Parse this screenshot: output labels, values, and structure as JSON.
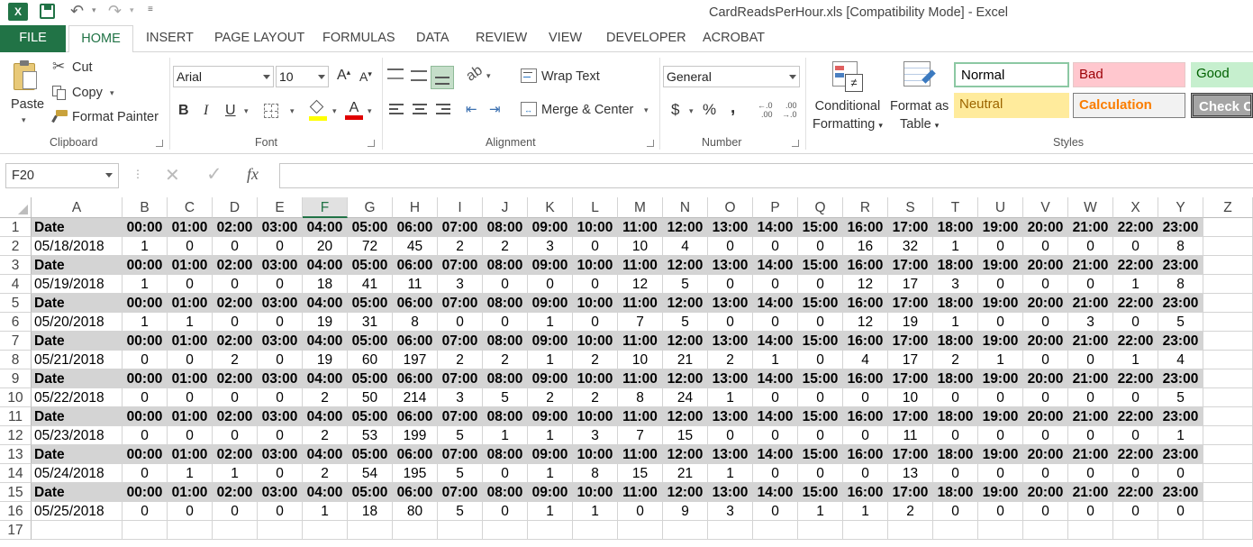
{
  "window": {
    "title": "CardReadsPerHour.xls  [Compatibility Mode] - Excel"
  },
  "tabs": [
    "FILE",
    "HOME",
    "INSERT",
    "PAGE LAYOUT",
    "FORMULAS",
    "DATA",
    "REVIEW",
    "VIEW",
    "DEVELOPER",
    "ACROBAT"
  ],
  "clipboard": {
    "paste": "Paste",
    "cut": "Cut",
    "copy": "Copy",
    "format_painter": "Format Painter",
    "label": "Clipboard"
  },
  "font": {
    "name": "Arial",
    "size": "10",
    "label": "Font",
    "bold": "B",
    "italic": "I",
    "underline": "U",
    "grow": "A",
    "shrink": "A",
    "font_color_letter": "A"
  },
  "alignment": {
    "wrap_text": "Wrap Text",
    "merge_center": "Merge & Center",
    "label": "Alignment"
  },
  "number": {
    "format": "General",
    "currency": "$",
    "percent": "%",
    "comma": ",",
    "inc_decimal": "←.0\n.00",
    "label": "Number"
  },
  "conditional": {
    "line1": "Conditional",
    "line2": "Formatting"
  },
  "format_table": {
    "line1": "Format as",
    "line2": "Table"
  },
  "styles": {
    "label": "Styles",
    "normal": "Normal",
    "bad": "Bad",
    "good": "Good",
    "neutral": "Neutral",
    "calculation": "Calculation",
    "check_cell": "Check Cell"
  },
  "formula_bar": {
    "name_box": "F20",
    "fx": "fx",
    "value": ""
  },
  "colors": {
    "accent": "#217346",
    "header_fill": "#d4d4d4"
  },
  "sheet": {
    "columns": [
      "A",
      "B",
      "C",
      "D",
      "E",
      "F",
      "G",
      "H",
      "I",
      "J",
      "K",
      "L",
      "M",
      "N",
      "O",
      "P",
      "Q",
      "R",
      "S",
      "T",
      "U",
      "V",
      "W",
      "X",
      "Y",
      "Z"
    ],
    "selected_column": "F",
    "row_numbers": [
      "1",
      "2",
      "3",
      "4",
      "5",
      "6",
      "7",
      "8",
      "9",
      "10",
      "11",
      "12",
      "13",
      "14",
      "15",
      "16",
      "17"
    ],
    "header_row": [
      "Date",
      "00:00",
      "01:00",
      "02:00",
      "03:00",
      "04:00",
      "05:00",
      "06:00",
      "07:00",
      "08:00",
      "09:00",
      "10:00",
      "11:00",
      "12:00",
      "13:00",
      "14:00",
      "15:00",
      "16:00",
      "17:00",
      "18:00",
      "19:00",
      "20:00",
      "21:00",
      "22:00",
      "23:00"
    ],
    "data_rows": [
      [
        "05/18/2018",
        "1",
        "0",
        "0",
        "0",
        "20",
        "72",
        "45",
        "2",
        "2",
        "3",
        "0",
        "10",
        "4",
        "0",
        "0",
        "0",
        "16",
        "32",
        "1",
        "0",
        "0",
        "0",
        "0",
        "8"
      ],
      [
        "05/19/2018",
        "1",
        "0",
        "0",
        "0",
        "18",
        "41",
        "11",
        "3",
        "0",
        "0",
        "0",
        "12",
        "5",
        "0",
        "0",
        "0",
        "12",
        "17",
        "3",
        "0",
        "0",
        "0",
        "1",
        "8"
      ],
      [
        "05/20/2018",
        "1",
        "1",
        "0",
        "0",
        "19",
        "31",
        "8",
        "0",
        "0",
        "1",
        "0",
        "7",
        "5",
        "0",
        "0",
        "0",
        "12",
        "19",
        "1",
        "0",
        "0",
        "3",
        "0",
        "5"
      ],
      [
        "05/21/2018",
        "0",
        "0",
        "2",
        "0",
        "19",
        "60",
        "197",
        "2",
        "2",
        "1",
        "2",
        "10",
        "21",
        "2",
        "1",
        "0",
        "4",
        "17",
        "2",
        "1",
        "0",
        "0",
        "1",
        "4"
      ],
      [
        "05/22/2018",
        "0",
        "0",
        "0",
        "0",
        "2",
        "50",
        "214",
        "3",
        "5",
        "2",
        "2",
        "8",
        "24",
        "1",
        "0",
        "0",
        "0",
        "10",
        "0",
        "0",
        "0",
        "0",
        "0",
        "5"
      ],
      [
        "05/23/2018",
        "0",
        "0",
        "0",
        "0",
        "2",
        "53",
        "199",
        "5",
        "1",
        "1",
        "3",
        "7",
        "15",
        "0",
        "0",
        "0",
        "0",
        "11",
        "0",
        "0",
        "0",
        "0",
        "0",
        "1"
      ],
      [
        "05/24/2018",
        "0",
        "1",
        "1",
        "0",
        "2",
        "54",
        "195",
        "5",
        "0",
        "1",
        "8",
        "15",
        "21",
        "1",
        "0",
        "0",
        "0",
        "13",
        "0",
        "0",
        "0",
        "0",
        "0",
        "0"
      ],
      [
        "05/25/2018",
        "0",
        "0",
        "0",
        "0",
        "1",
        "18",
        "80",
        "5",
        "0",
        "1",
        "1",
        "0",
        "9",
        "3",
        "0",
        "1",
        "1",
        "2",
        "0",
        "0",
        "0",
        "0",
        "0",
        "0"
      ]
    ]
  }
}
